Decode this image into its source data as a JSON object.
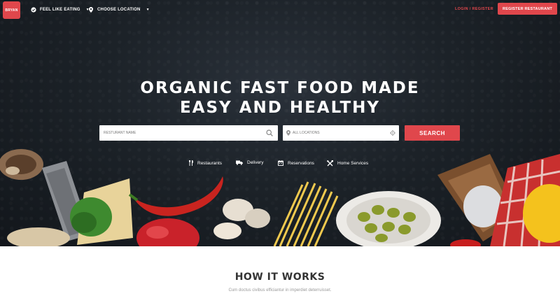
{
  "brand": {
    "logo_text": "BRYAN",
    "accent_color": "#e0474c"
  },
  "nav": {
    "feel_like_eating": "FEEL LIKE EATING",
    "choose_location": "CHOOSE LOCATION",
    "login_register": "LOGIN / REGISTER",
    "register_restaurant": "REGISTER RESTAURANT"
  },
  "hero": {
    "headline_line1": "ORGANIC FAST FOOD MADE",
    "headline_line2": "EASY AND HEALTHY"
  },
  "search": {
    "name_placeholder": "RESTURANT NAME",
    "location_placeholder": "ALL LOCATIONS",
    "button_label": "SEARCH"
  },
  "categories": [
    {
      "label": "Restaurants",
      "icon": "fork-knife-icon"
    },
    {
      "label": "Delivery",
      "icon": "truck-icon"
    },
    {
      "label": "Reservations",
      "icon": "calendar-icon"
    },
    {
      "label": "Home Services",
      "icon": "tools-icon"
    }
  ],
  "how_it_works": {
    "title": "HOW IT WORKS",
    "subtitle": "Cum doctus civibus efficiantur in imperdiet deterruisset."
  }
}
